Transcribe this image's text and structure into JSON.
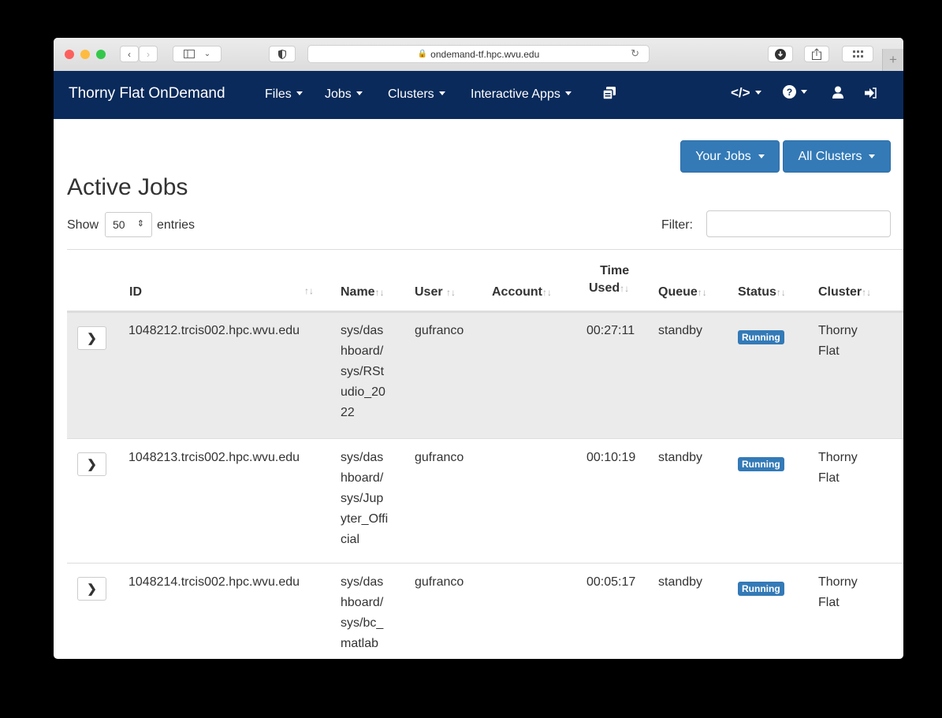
{
  "browser": {
    "url": "ondemand-tf.hpc.wvu.edu"
  },
  "navbar": {
    "brand": "Thorny Flat OnDemand",
    "items": [
      {
        "label": "Files"
      },
      {
        "label": "Jobs"
      },
      {
        "label": "Clusters"
      },
      {
        "label": "Interactive Apps"
      }
    ],
    "icons": [
      "sessions-icon",
      "developer-icon",
      "help-icon",
      "user-icon",
      "logout-icon"
    ]
  },
  "toolbar": {
    "your_jobs": "Your Jobs",
    "all_clusters": "All Clusters"
  },
  "page": {
    "title": "Active Jobs",
    "show_label": "Show",
    "entries_value": "50",
    "entries_label": "entries",
    "filter_label": "Filter:",
    "filter_value": ""
  },
  "table": {
    "headers": {
      "id": "ID",
      "name": "Name",
      "user": "User",
      "account": "Account",
      "time_line1": "Time",
      "time_line2": "Used",
      "queue": "Queue",
      "status": "Status",
      "cluster": "Cluster"
    },
    "rows": [
      {
        "id": "1048212.trcis002.hpc.wvu.edu",
        "name": [
          "sys/das",
          "hboard/",
          "sys/RSt",
          "udio_20",
          "22"
        ],
        "user": "gufranco",
        "account": "",
        "time": "00:27:11",
        "queue": "standby",
        "status": "Running",
        "cluster": [
          "Thorny",
          "Flat"
        ]
      },
      {
        "id": "1048213.trcis002.hpc.wvu.edu",
        "name": [
          "sys/das",
          "hboard/",
          "sys/Jup",
          "yter_Offi",
          "cial"
        ],
        "user": "gufranco",
        "account": "",
        "time": "00:10:19",
        "queue": "standby",
        "status": "Running",
        "cluster": [
          "Thorny",
          "Flat"
        ]
      },
      {
        "id": "1048214.trcis002.hpc.wvu.edu",
        "name": [
          "sys/das",
          "hboard/",
          "sys/bc_",
          "matlab"
        ],
        "user": "gufranco",
        "account": "",
        "time": "00:05:17",
        "queue": "standby",
        "status": "Running",
        "cluster": [
          "Thorny",
          "Flat"
        ]
      }
    ]
  }
}
